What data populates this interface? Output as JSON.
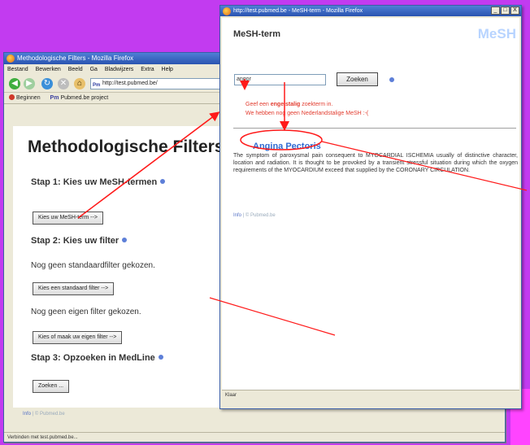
{
  "back_window": {
    "title": "Methodologische Filters - Mozilla Firefox",
    "menu": [
      "Bestand",
      "Bewerken",
      "Beeld",
      "Ga",
      "Bladwijzers",
      "Extra",
      "Help"
    ],
    "url": "http://test.pubmed.be/",
    "bookmarks": [
      "Beginnen",
      "Pubmed.be project"
    ],
    "page_title": "Methodologische Filters",
    "step1": "Stap 1: Kies uw MeSH-termen",
    "btn_mesh": "Kies uw MeSH-term -->",
    "step2": "Stap 2: Kies uw filter",
    "no_standard_filter": "Nog geen standaardfilter gekozen.",
    "btn_standard_filter": "Kies een standaard filter -->",
    "no_own_filter": "Nog geen eigen filter gekozen.",
    "btn_own_filter": "Kies of maak uw eigen filter -->",
    "step3": "Stap 3: Opzoeken in MedLine",
    "btn_search": "Zoeken ...",
    "footer_info": "Info",
    "footer_copy": "| © Pubmed.be",
    "status": "Verbinden met test.pubmed.be..."
  },
  "popup": {
    "title": "http://test.pubmed.be - MeSH-term - Mozilla Firefox",
    "controls": [
      "_",
      "□",
      "X"
    ],
    "header_title": "MeSH-term",
    "logo": "MeSH",
    "search_value": "angor",
    "search_button": "Zoeken",
    "msg1_prefix": "Geef een ",
    "msg1_bold": "engelstalig",
    "msg1_suffix": " zoekterm in.",
    "msg2": "We hebben nog geen Nederlandstalige MeSH :-(",
    "result_title": "Angina Pectoris",
    "result_desc": "The symptom of paroxysmal pain consequent to MYOCARDIAL ISCHEMIA usually of distinctive character, location and radiation. It is thought to be provoked by a transient stressful situation during which the oxygen requirements of the MYOCARDIUM exceed that supplied by the CORONARY CIRCULATION.",
    "footer_info": "Info",
    "footer_copy": "| © Pubmed.be",
    "status": "Klaar"
  },
  "colors": {
    "background": "#c23bf0",
    "annotation": "#ff1a1a",
    "link_blue": "#2f6ad1",
    "error_red": "#e23b2e"
  }
}
